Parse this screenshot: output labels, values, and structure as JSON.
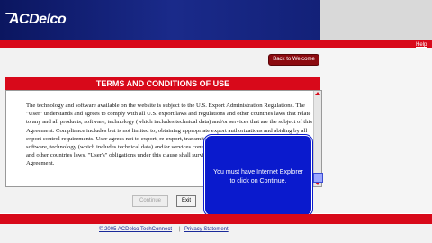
{
  "header": {
    "logo_text": "ACDelco",
    "help_label": "Help"
  },
  "nav": {
    "back_label": "Back to Welcome"
  },
  "terms": {
    "title": "TERMS AND CONDITIONS OF USE",
    "body": "The technology and software available on the website is subject to the U.S. Export Administration Regulations. The \"User\" understands and agrees to comply with all U.S. export laws and regulations and other countries laws that relate to any and all products, software, technology (which includes technical data) and/or services that are the subject of this Agreement. Compliance includes but is not limited to, obtaining appropriate export authorizations and abiding by all export control requirements. User agrees not to export, re-export, transmit or otherwise transfer any products, software, technology (which includes technical data) and/or services contrary to all U.S. export laws and regulations and other countries laws. \"User's\" obligations under this clause shall survive the expiration or termination of this Agreement."
  },
  "buttons": {
    "continue_label": "Continue",
    "exit_label": "Exit"
  },
  "tooltip": {
    "text": "You must have Internet Explorer to click on Continue."
  },
  "footer": {
    "copyright": "© 2005 ACDelco TechConnect",
    "separator": "|",
    "privacy": "Privacy Statement"
  },
  "colors": {
    "brand_blue": "#0d1a6b",
    "brand_red": "#d8091a",
    "tooltip_blue": "#0a1acd"
  },
  "icons": [
    "scroll-up-icon",
    "scroll-down-icon",
    "cursor-icon"
  ]
}
